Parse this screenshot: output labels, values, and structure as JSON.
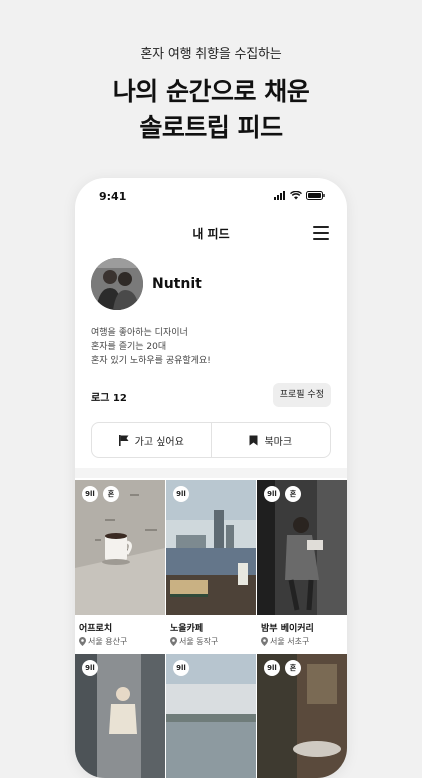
{
  "promo": {
    "subtitle": "혼자 여행 취향을 수집하는",
    "headline_1": "나의 순간으로 채운",
    "headline_2": "솔로트립 피드"
  },
  "status_bar": {
    "time": "9:41"
  },
  "header": {
    "title": "내 피드"
  },
  "profile": {
    "name": "Nutnit",
    "bio": [
      "여행을 좋아하는 디자이너",
      "혼자를 즐기는 20대",
      "혼자 있기 노하우를 공유할게요!"
    ],
    "log_count": "로그 12",
    "edit_label": "프로필 수정"
  },
  "actions": {
    "want_to_go": "가고 싶어요",
    "bookmark": "북마크"
  },
  "badges": {
    "meal": "9ll",
    "solo": "혼"
  },
  "feed": [
    {
      "title": "어프로치",
      "location": "서울 용산구"
    },
    {
      "title": "노을카페",
      "location": "서울 동작구"
    },
    {
      "title": "밤부 베이커리",
      "location": "서울 서초구"
    },
    {
      "title": "",
      "location": ""
    },
    {
      "title": "",
      "location": ""
    },
    {
      "title": "",
      "location": ""
    }
  ]
}
